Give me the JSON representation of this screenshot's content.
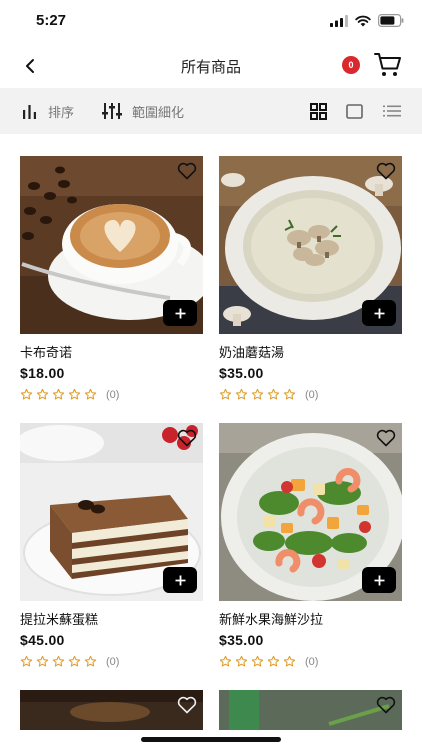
{
  "status_bar": {
    "time": "5:27"
  },
  "nav": {
    "title": "所有商品",
    "cart_count": "0"
  },
  "toolbar": {
    "sort_label": "排序",
    "filter_label": "範圍細化"
  },
  "products": [
    {
      "name": "卡布奇诺",
      "price": "$18.00",
      "rating_count": "(0)",
      "image": "cappuccino"
    },
    {
      "name": "奶油蘑菇湯",
      "price": "$35.00",
      "rating_count": "(0)",
      "image": "mushroom-soup"
    },
    {
      "name": "提拉米蘇蛋糕",
      "price": "$45.00",
      "rating_count": "(0)",
      "image": "tiramisu"
    },
    {
      "name": "新鮮水果海鮮沙拉",
      "price": "$35.00",
      "rating_count": "(0)",
      "image": "seafood-salad"
    }
  ],
  "colors": {
    "accent_star": "#e0a030",
    "badge": "#d9282e",
    "toolbar_bg": "#f2f2f2"
  }
}
